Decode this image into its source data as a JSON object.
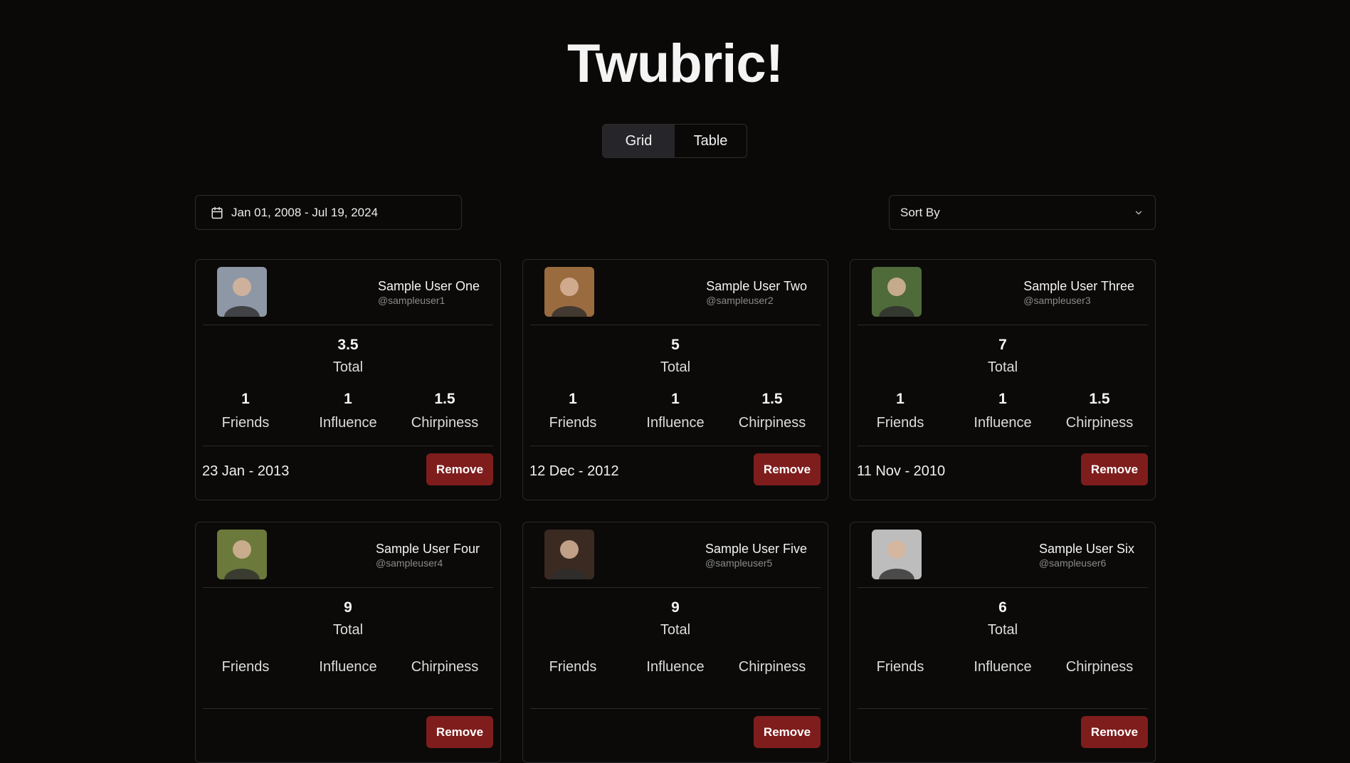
{
  "app": {
    "title": "Twubric!"
  },
  "view_toggle": {
    "grid_label": "Grid",
    "table_label": "Table",
    "active": "Grid"
  },
  "filters": {
    "date_range": "Jan 01, 2008 - Jul 19, 2024",
    "sort_label": "Sort By"
  },
  "labels": {
    "total": "Total",
    "friends": "Friends",
    "influence": "Influence",
    "chirpiness": "Chirpiness",
    "remove": "Remove"
  },
  "users": [
    {
      "name": "Sample User One",
      "handle": "@sampleuser1",
      "total": "3.5",
      "friends": "1",
      "influence": "1",
      "chirpiness": "1.5",
      "date": "23 Jan - 2013",
      "avatar_color": "#8e97a6"
    },
    {
      "name": "Sample User Two",
      "handle": "@sampleuser2",
      "total": "5",
      "friends": "1",
      "influence": "1",
      "chirpiness": "1.5",
      "date": "12 Dec - 2012",
      "avatar_color": "#9a6b3f"
    },
    {
      "name": "Sample User Three",
      "handle": "@sampleuser3",
      "total": "7",
      "friends": "1",
      "influence": "1",
      "chirpiness": "1.5",
      "date": "11 Nov - 2010",
      "avatar_color": "#4f6b3a"
    },
    {
      "name": "Sample User Four",
      "handle": "@sampleuser4",
      "total": "9",
      "friends": "",
      "influence": "",
      "chirpiness": "",
      "date": "",
      "avatar_color": "#6b7a3a"
    },
    {
      "name": "Sample User Five",
      "handle": "@sampleuser5",
      "total": "9",
      "friends": "",
      "influence": "",
      "chirpiness": "",
      "date": "",
      "avatar_color": "#3a2a22"
    },
    {
      "name": "Sample User Six",
      "handle": "@sampleuser6",
      "total": "6",
      "friends": "",
      "influence": "",
      "chirpiness": "",
      "date": "",
      "avatar_color": "#bdbdbd"
    }
  ],
  "colors": {
    "background": "#0a0908",
    "card_border": "#2a2a2c",
    "remove_button": "#7f1d1d",
    "active_tab": "#26262a"
  }
}
